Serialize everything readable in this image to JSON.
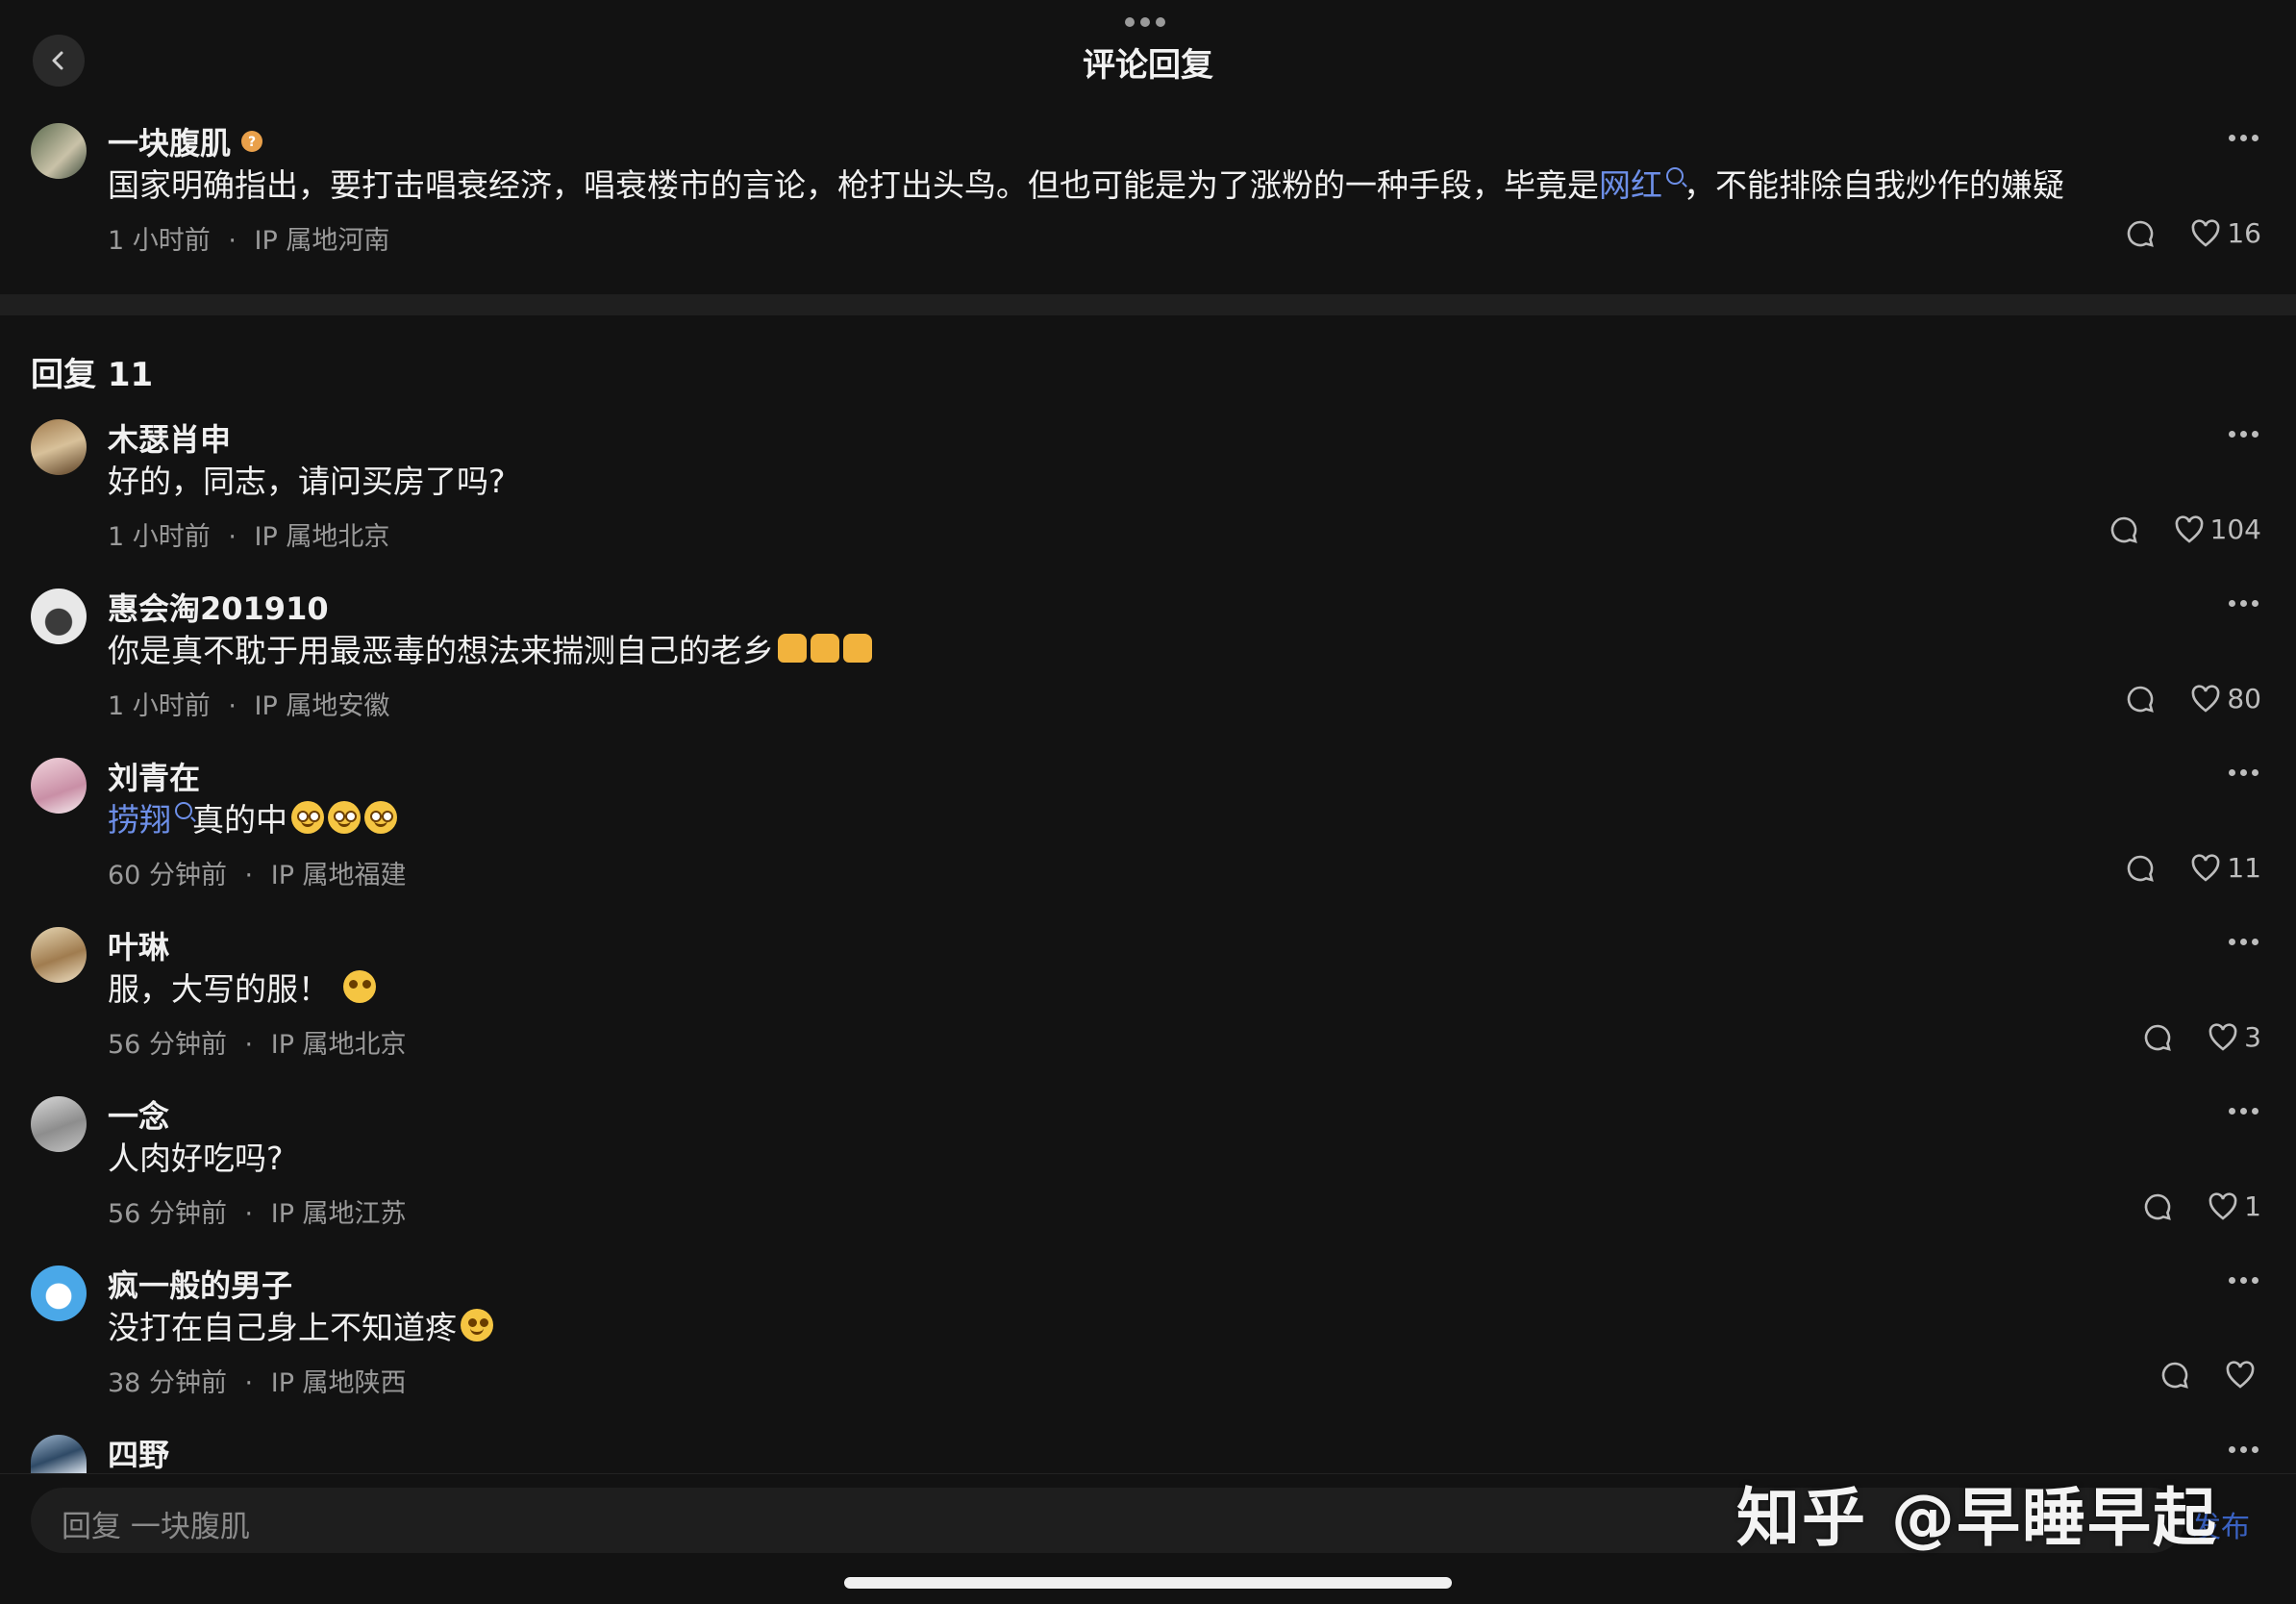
{
  "header": {
    "title": "评论回复"
  },
  "main_comment": {
    "author": "一块腹肌",
    "text_before": "国家明确指出，要打击唱衰经济，唱衰楼市的言论，枪打出头鸟。但也可能是为了涨粉的一种手段，毕竟是",
    "link": "网红",
    "text_after": "，不能排除自我炒作的嫌疑",
    "time": "1 小时前",
    "ip": "IP 属地河南",
    "likes": "16"
  },
  "replies_label": "回复 11",
  "replies": [
    {
      "author": "木瑟肖申",
      "text": "好的，同志，请问买房了吗?",
      "time": "1 小时前",
      "ip": "IP 属地北京",
      "likes": "104"
    },
    {
      "author": "惠会淘201910",
      "text": "你是真不耽于用最恶毒的想法来揣测自己的老乡",
      "time": "1 小时前",
      "ip": "IP 属地安徽",
      "likes": "80"
    },
    {
      "author": "刘青在",
      "link": "捞翔",
      "text": " 真的中",
      "time": "60 分钟前",
      "ip": "IP 属地福建",
      "likes": "11"
    },
    {
      "author": "叶琳",
      "text": "服，大写的服！",
      "time": "56 分钟前",
      "ip": "IP 属地北京",
      "likes": "3"
    },
    {
      "author": "一念",
      "text": "人肉好吃吗?",
      "time": "56 分钟前",
      "ip": "IP 属地江苏",
      "likes": "1"
    },
    {
      "author": "疯一般的男子",
      "text": "没打在自己身上不知道疼",
      "time": "38 分钟前",
      "ip": "IP 属地陕西",
      "likes": ""
    },
    {
      "author": "四野"
    }
  ],
  "input": {
    "placeholder": "回复 一块腹肌",
    "publish": "发布"
  },
  "watermark": "知乎 @早睡早起",
  "meta_sep": "·",
  "colors": {
    "background": "#121212",
    "link": "#6d8fe8",
    "muted": "#9a9a9a"
  }
}
